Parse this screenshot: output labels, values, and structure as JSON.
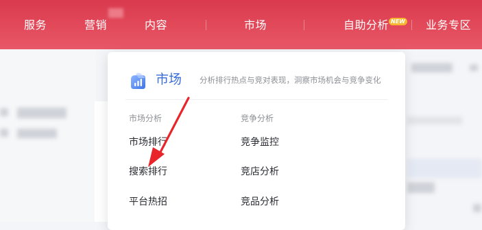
{
  "topnav": {
    "items": [
      {
        "label": "服务"
      },
      {
        "label": "营销"
      },
      {
        "label": "内容"
      },
      {
        "label": "市场"
      },
      {
        "label": "自助分析",
        "badge": "NEW"
      },
      {
        "label": "业务专区"
      }
    ],
    "colors": {
      "background": "#e04858",
      "badge": "#f7b731"
    }
  },
  "dropdown": {
    "title": "市场",
    "icon": "chart-bar-icon",
    "description": "分析排行热点与竞对表现，洞察市场机会与竞争变化",
    "columns": [
      {
        "heading": "市场分析",
        "links": [
          "市场排行",
          "搜索排行",
          "平台热招"
        ]
      },
      {
        "heading": "竞争分析",
        "links": [
          "竞争监控",
          "竞店分析",
          "竞品分析"
        ]
      }
    ],
    "accent_color": "#3a6fd8"
  },
  "annotation": {
    "type": "red-arrow",
    "target": "搜索排行",
    "color": "#e8252b"
  }
}
